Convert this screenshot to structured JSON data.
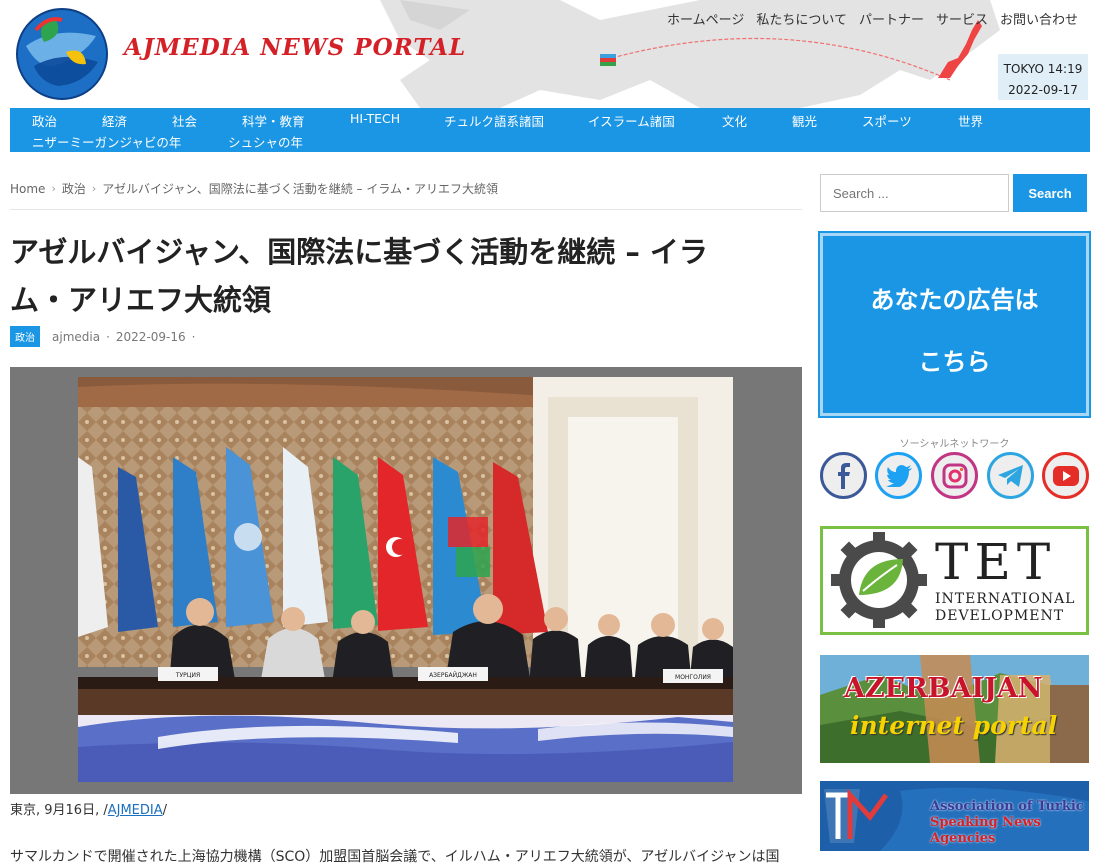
{
  "header": {
    "brand": "AJMEDIA NEWS PORTAL",
    "top_menu": [
      "ホームページ",
      "私たちについて",
      "パートナー",
      "サービス",
      "お問い合わせ"
    ],
    "clock_time": "TOKYO 14:19",
    "clock_date": "2022-09-17"
  },
  "nav": {
    "row1": [
      "政治",
      "経済",
      "社会",
      "科学・教育",
      "HI-TECH",
      "チュルク語系諸国",
      "イスラーム諸国",
      "文化",
      "観光",
      "スポーツ",
      "世界"
    ],
    "row2": [
      "ニザーミーガンジャビの年",
      "シュシャの年"
    ]
  },
  "breadcrumb": {
    "home": "Home",
    "category": "政治",
    "current": "アゼルバイジャン、国際法に基づく活動を継続 – イラム・アリエフ大統領"
  },
  "article": {
    "title_line1": "アゼルバイジャン、国際法に基づく活動を継続 – イラ",
    "title_line2": "ム・アリエフ大統領",
    "category": "政治",
    "author": "ajmedia",
    "date": "2022-09-16",
    "dot": "·",
    "photo_labels": {
      "turkey": "ТУРЦИЯ",
      "azerbaijan": "АЗЕРБАЙДЖАН",
      "mongolia": "МОНГОЛИЯ"
    },
    "caption_prefix": "東京, 9月16日, /",
    "caption_link": "AJMEDIA",
    "caption_suffix": "/",
    "body_start": "サマルカンドで開催された上海協力機構（SCO）加盟国首脳会議で、イルハム・アリエフ大統領が、アゼルバイジャンは国"
  },
  "sidebar": {
    "search_placeholder": "Search ...",
    "search_button": "Search",
    "ad_line1": "あなたの広告は",
    "ad_line2": "こちら",
    "social_label": "ソーシャルネットワーク",
    "social_icons": [
      "facebook-icon",
      "twitter-icon",
      "instagram-icon",
      "telegram-icon",
      "youtube-icon"
    ],
    "tet_big": "TET",
    "tet_line1": "INTERNATIONAL",
    "tet_line2": "DEVELOPMENT",
    "azp_line1": "AZERBAIJAN",
    "azp_line2": "internet portal",
    "tka_line1": "Association of Turkic",
    "tka_line2": "Speaking News Agencies"
  },
  "colors": {
    "accent": "#1a96e4",
    "brand_red": "#d42027"
  }
}
